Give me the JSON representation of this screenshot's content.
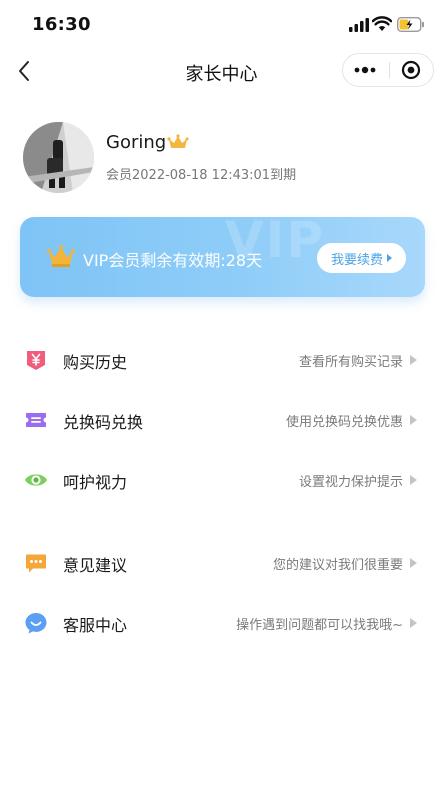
{
  "status_bar": {
    "time": "16:30"
  },
  "nav": {
    "title": "家长中心"
  },
  "profile": {
    "username": "Goring",
    "membership_expiry": "会员2022-08-18 12:43:01到期"
  },
  "vip": {
    "watermark": "VIP",
    "remaining_text": "VIP会员剩余有效期:28天",
    "renew_label": "我要续费"
  },
  "menu": [
    {
      "label": "购买历史",
      "hint": "查看所有购买记录",
      "icon": "yen-tag-icon",
      "color": "#ef5d7a"
    },
    {
      "label": "兑换码兑换",
      "hint": "使用兑换码兑换优惠",
      "icon": "ticket-icon",
      "color": "#9b6cf0"
    },
    {
      "label": "呵护视力",
      "hint": "设置视力保护提示",
      "icon": "eye-icon",
      "color": "#7ccf5e"
    },
    {
      "label": "意见建议",
      "hint": "您的建议对我们很重要",
      "icon": "message-icon",
      "color": "#f5a83a"
    },
    {
      "label": "客服中心",
      "hint": "操作遇到问题都可以找我哦~",
      "icon": "customer-service-icon",
      "color": "#5c9ff2"
    }
  ]
}
